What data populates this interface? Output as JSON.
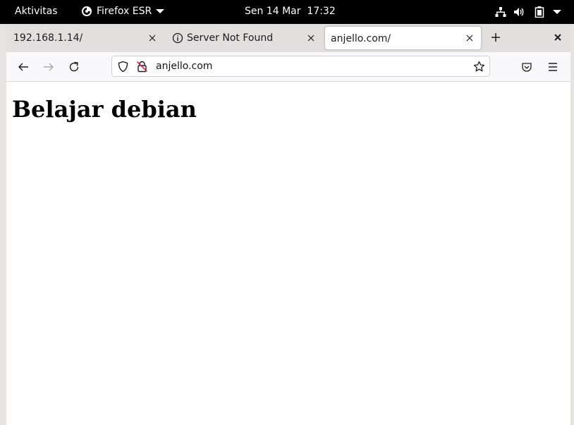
{
  "topbar": {
    "activities_label": "Aktivitas",
    "app_name": "Firefox ESR",
    "clock": "Sen 14 Mar  17:32",
    "icons": [
      "network-icon",
      "volume-icon",
      "battery-icon",
      "system-menu-caret-icon"
    ]
  },
  "tabs": [
    {
      "label": "192.168.1.14/",
      "active": false,
      "icon": null
    },
    {
      "label": "Server Not Found",
      "active": false,
      "icon": "info-icon"
    },
    {
      "label": "anjello.com/",
      "active": true,
      "icon": null
    }
  ],
  "navbar": {
    "url": "anjello.com",
    "icons": [
      "back-arrow-icon",
      "forward-arrow-icon",
      "reload-icon",
      "shield-icon",
      "insecure-lock-icon",
      "bookmark-star-icon",
      "pocket-icon",
      "hamburger-menu-icon"
    ]
  },
  "page": {
    "heading": "Belajar debian"
  },
  "colors": {
    "topbar_bg": "#000000",
    "tabstrip_bg": "#e1e0de",
    "navbar_bg": "#f9f9fb",
    "insecure_red": "#e22850"
  }
}
